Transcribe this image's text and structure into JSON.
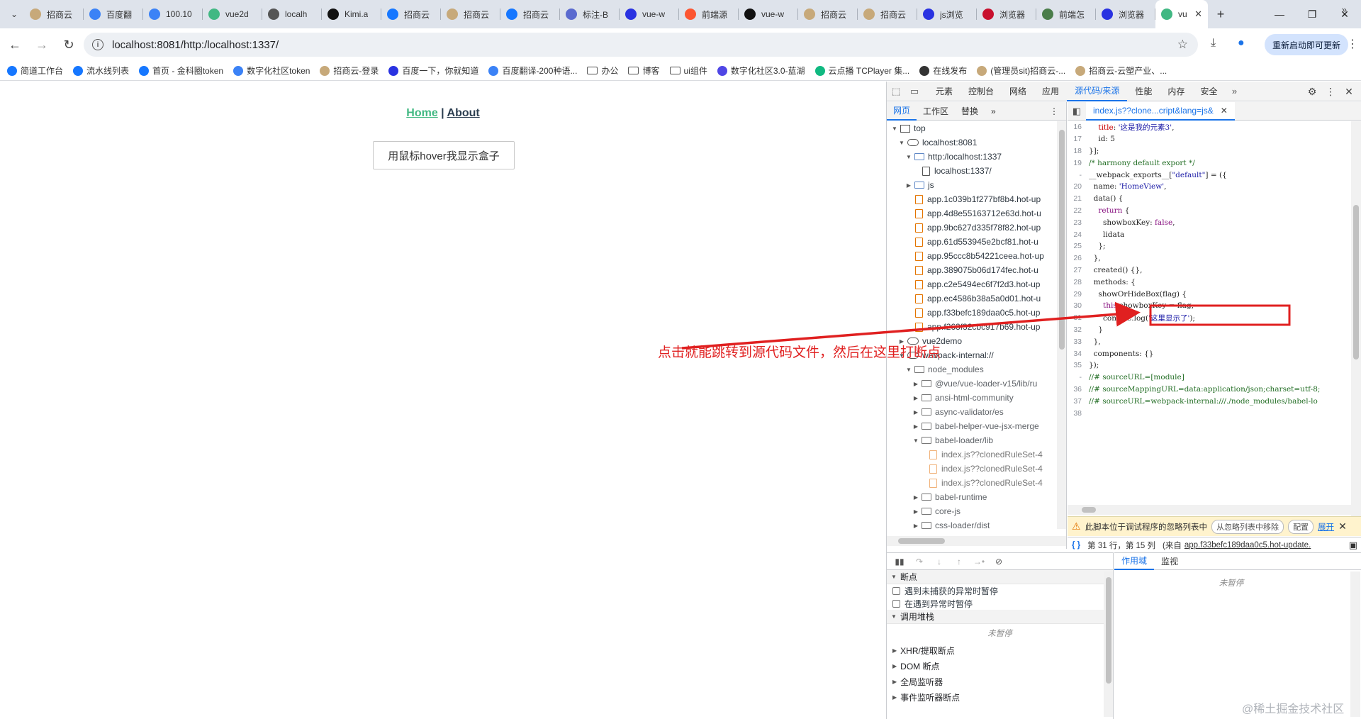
{
  "browser": {
    "tabs": [
      {
        "title": "招商云",
        "icon": "yunshang-icon",
        "color": "#c7a97a"
      },
      {
        "title": "百度翻",
        "icon": "fanyi-icon",
        "color": "#3b82f6"
      },
      {
        "title": "100.10",
        "icon": "loader-icon",
        "color": "#3b82f6"
      },
      {
        "title": "vue2d",
        "icon": "vue-icon",
        "color": "#41b883"
      },
      {
        "title": "localh",
        "icon": "globe-icon",
        "color": "#555555"
      },
      {
        "title": "Kimi.a",
        "icon": "kimi-icon",
        "color": "#111111"
      },
      {
        "title": "招商云",
        "icon": "zsy-icon",
        "color": "#1677ff"
      },
      {
        "title": "招商云",
        "icon": "yunshang-icon",
        "color": "#c7a97a"
      },
      {
        "title": "招商云",
        "icon": "zsy-icon",
        "color": "#1677ff"
      },
      {
        "title": "标注-B",
        "icon": "bookmark-icon",
        "color": "#5a6acf"
      },
      {
        "title": "vue-w",
        "icon": "baidu-icon",
        "color": "#2932e1"
      },
      {
        "title": "前端源",
        "icon": "csdn-icon",
        "color": "#fc5531"
      },
      {
        "title": "vue-w",
        "icon": "github-icon",
        "color": "#111111"
      },
      {
        "title": "招商云",
        "icon": "yunshang-icon",
        "color": "#c7a97a"
      },
      {
        "title": "招商云",
        "icon": "yunshang-icon",
        "color": "#c7a97a"
      },
      {
        "title": "js浏览",
        "icon": "baidu-icon",
        "color": "#2932e1"
      },
      {
        "title": "浏览器",
        "icon": "cnblogs-icon",
        "color": "#c8102e"
      },
      {
        "title": "前端怎",
        "icon": "doc-icon",
        "color": "#4a7d4a"
      },
      {
        "title": "浏览器",
        "icon": "baidu-icon",
        "color": "#2932e1"
      }
    ],
    "active_tab": {
      "title": "vu",
      "icon": "vue-icon",
      "color": "#41b883"
    },
    "url": "localhost:8081/http:/localhost:1337/",
    "restart_label": "重新启动即可更新",
    "bookmarks": [
      {
        "label": "简道工作台",
        "color": "#1677ff",
        "kind": "fav"
      },
      {
        "label": "流水线列表",
        "color": "#1677ff",
        "kind": "fav"
      },
      {
        "label": "首页 - 金科圈token",
        "color": "#1677ff",
        "kind": "fav"
      },
      {
        "label": "数字化社区token",
        "color": "#3b82f6",
        "kind": "fav"
      },
      {
        "label": "招商云-登录",
        "color": "#c7a97a",
        "kind": "fav"
      },
      {
        "label": "百度一下，你就知道",
        "color": "#2932e1",
        "kind": "fav"
      },
      {
        "label": "百度翻译-200种语...",
        "color": "#3b82f6",
        "kind": "fav"
      },
      {
        "label": "办公",
        "color": "#555555",
        "kind": "folder"
      },
      {
        "label": "博客",
        "color": "#555555",
        "kind": "folder"
      },
      {
        "label": "ui组件",
        "color": "#555555",
        "kind": "folder"
      },
      {
        "label": "数字化社区3.0-蓝湖",
        "color": "#4f46e5",
        "kind": "fav"
      },
      {
        "label": "云点播 TCPlayer 集...",
        "color": "#10b981",
        "kind": "fav"
      },
      {
        "label": "在线发布",
        "color": "#333333",
        "kind": "fav"
      },
      {
        "label": "(管理员sit)招商云-...",
        "color": "#c7a97a",
        "kind": "fav"
      },
      {
        "label": "招商云-云塑产业、...",
        "color": "#c7a97a",
        "kind": "fav"
      }
    ]
  },
  "page": {
    "nav_home": "Home",
    "nav_sep": " | ",
    "nav_about": "About",
    "hover_button": "用鼠标hover我显示盒子"
  },
  "devtools": {
    "tabs": [
      "元素",
      "控制台",
      "网络",
      "应用",
      "源代码/来源",
      "性能",
      "内存",
      "安全"
    ],
    "selected_tab": "源代码/来源",
    "nav_tabs": [
      "网页",
      "工作区",
      "替换"
    ],
    "editor_tab": "index.js??clone...cript&lang=js&",
    "tree": [
      {
        "d": 0,
        "arr": "▼",
        "ic": "fr",
        "t": "top"
      },
      {
        "d": 1,
        "arr": "▼",
        "ic": "cl",
        "t": "localhost:8081"
      },
      {
        "d": 2,
        "arr": "▼",
        "ic": "fo",
        "t": "http:/localhost:1337"
      },
      {
        "d": 3,
        "arr": "",
        "ic": "fi grey",
        "t": "localhost:1337/"
      },
      {
        "d": 2,
        "arr": "▶",
        "ic": "fo",
        "t": "js"
      },
      {
        "d": 2,
        "arr": "",
        "ic": "fi",
        "t": "app.1c039b1f277bf8b4.hot-up"
      },
      {
        "d": 2,
        "arr": "",
        "ic": "fi",
        "t": "app.4d8e55163712e63d.hot-u"
      },
      {
        "d": 2,
        "arr": "",
        "ic": "fi",
        "t": "app.9bc627d335f78f82.hot-up"
      },
      {
        "d": 2,
        "arr": "",
        "ic": "fi",
        "t": "app.61d553945e2bcf81.hot-u"
      },
      {
        "d": 2,
        "arr": "",
        "ic": "fi",
        "t": "app.95ccc8b54221ceea.hot-up"
      },
      {
        "d": 2,
        "arr": "",
        "ic": "fi",
        "t": "app.389075b06d174fec.hot-u"
      },
      {
        "d": 2,
        "arr": "",
        "ic": "fi",
        "t": "app.c2e5494ec6f7f2d3.hot-up"
      },
      {
        "d": 2,
        "arr": "",
        "ic": "fi",
        "t": "app.ec4586b38a5a0d01.hot-u"
      },
      {
        "d": 2,
        "arr": "",
        "ic": "fi",
        "t": "app.f33befc189daa0c5.hot-up"
      },
      {
        "d": 2,
        "arr": "",
        "ic": "fi",
        "t": "app.f263f32cbc917b69.hot-up"
      },
      {
        "d": 1,
        "arr": "▶",
        "ic": "cl",
        "t": "vue2demo"
      },
      {
        "d": 1,
        "arr": "▼",
        "ic": "cl",
        "t": "webpack-internal://"
      },
      {
        "d": 2,
        "arr": "▼",
        "ic": "fo grey",
        "t": "node_modules",
        "cls": "dim"
      },
      {
        "d": 3,
        "arr": "▶",
        "ic": "fo grey",
        "t": "@vue/vue-loader-v15/lib/ru",
        "cls": "dim"
      },
      {
        "d": 3,
        "arr": "▶",
        "ic": "fo grey",
        "t": "ansi-html-community",
        "cls": "dim"
      },
      {
        "d": 3,
        "arr": "▶",
        "ic": "fo grey",
        "t": "async-validator/es",
        "cls": "dim"
      },
      {
        "d": 3,
        "arr": "▶",
        "ic": "fo grey",
        "t": "babel-helper-vue-jsx-merge",
        "cls": "dim"
      },
      {
        "d": 3,
        "arr": "▼",
        "ic": "fo grey",
        "t": "babel-loader/lib",
        "cls": "dim"
      },
      {
        "d": 4,
        "arr": "",
        "ic": "fi light",
        "t": "index.js??clonedRuleSet-4",
        "cls": "muted"
      },
      {
        "d": 4,
        "arr": "",
        "ic": "fi light",
        "t": "index.js??clonedRuleSet-4",
        "cls": "muted"
      },
      {
        "d": 4,
        "arr": "",
        "ic": "fi light",
        "t": "index.js??clonedRuleSet-4",
        "cls": "muted"
      },
      {
        "d": 3,
        "arr": "▶",
        "ic": "fo grey",
        "t": "babel-runtime",
        "cls": "dim"
      },
      {
        "d": 3,
        "arr": "▶",
        "ic": "fo grey",
        "t": "core-js",
        "cls": "dim"
      },
      {
        "d": 3,
        "arr": "▶",
        "ic": "fo grey",
        "t": "css-loader/dist",
        "cls": "dim"
      }
    ],
    "code": [
      {
        "n": "16",
        "h": "    <span class=\"pr\">title</span>: <span class=\"st\">'这是我的元素3'</span>,"
      },
      {
        "n": "17",
        "h": "    id: 5"
      },
      {
        "n": "18",
        "h": "}];"
      },
      {
        "n": "19",
        "h": "<span class=\"cm\">/* harmony default export */</span>"
      },
      {
        "n": "-",
        "h": "__webpack_exports__[<span class=\"st\">\"default\"</span>] = ({"
      },
      {
        "n": "20",
        "h": "  name: <span class=\"st\">'HomeView'</span>,"
      },
      {
        "n": "21",
        "h": "  data() {"
      },
      {
        "n": "22",
        "h": "    <span class=\"kw\">return</span> {"
      },
      {
        "n": "23",
        "h": "      showboxKey: <span class=\"kw\">false</span>,"
      },
      {
        "n": "24",
        "h": "      lidata"
      },
      {
        "n": "25",
        "h": "    };"
      },
      {
        "n": "26",
        "h": "  },"
      },
      {
        "n": "27",
        "h": "  created() {},"
      },
      {
        "n": "28",
        "h": "  methods: {"
      },
      {
        "n": "29",
        "h": "    showOrHideBox(flag) {"
      },
      {
        "n": "30",
        "h": "      <span class=\"kw\">this</span>.showboxKey = flag;"
      },
      {
        "n": "31",
        "h": "      console.log(<span class=\"st\">'这里显示了'</span>);"
      },
      {
        "n": "32",
        "h": "    }"
      },
      {
        "n": "33",
        "h": "  },"
      },
      {
        "n": "34",
        "h": "  components: {}"
      },
      {
        "n": "35",
        "h": "});"
      },
      {
        "n": "-",
        "h": "<span class=\"cm\">//# sourceURL=[module]</span>"
      },
      {
        "n": "36",
        "h": "<span class=\"cm\">//# sourceMappingURL=data:application/json;charset=utf-8;</span>"
      },
      {
        "n": "37",
        "h": "<span class=\"cm\">//# sourceURL=webpack-internal:///./node_modules/babel-lo</span>"
      },
      {
        "n": "38",
        "h": ""
      }
    ],
    "ignore_bar": {
      "text": "此脚本位于调试程序的忽略列表中",
      "remove": "从忽略列表中移除",
      "config": "配置",
      "expand": "展开"
    },
    "status": {
      "position": "第 31 行，第 15 列",
      "from": "(来自",
      "file": "app.f33befc189daa0c5.hot-update."
    },
    "breakpoints_head": "断点",
    "cb_uncaught": "遇到未捕获的异常时暂停",
    "cb_caught": "在遇到异常时暂停",
    "callstack_head": "调用堆栈",
    "not_paused": "未暂停",
    "sub_sections": [
      "XHR/提取断点",
      "DOM 断点",
      "全局监听器",
      "事件监听器断点"
    ],
    "scope_tabs": [
      "作用域",
      "监视"
    ],
    "scope_not_paused": "未暂停"
  },
  "annotation": {
    "text": "点击就能跳转到源代码文件，然后在这里打断点",
    "color": "#e02020"
  },
  "watermark": "@稀土掘金技术社区"
}
